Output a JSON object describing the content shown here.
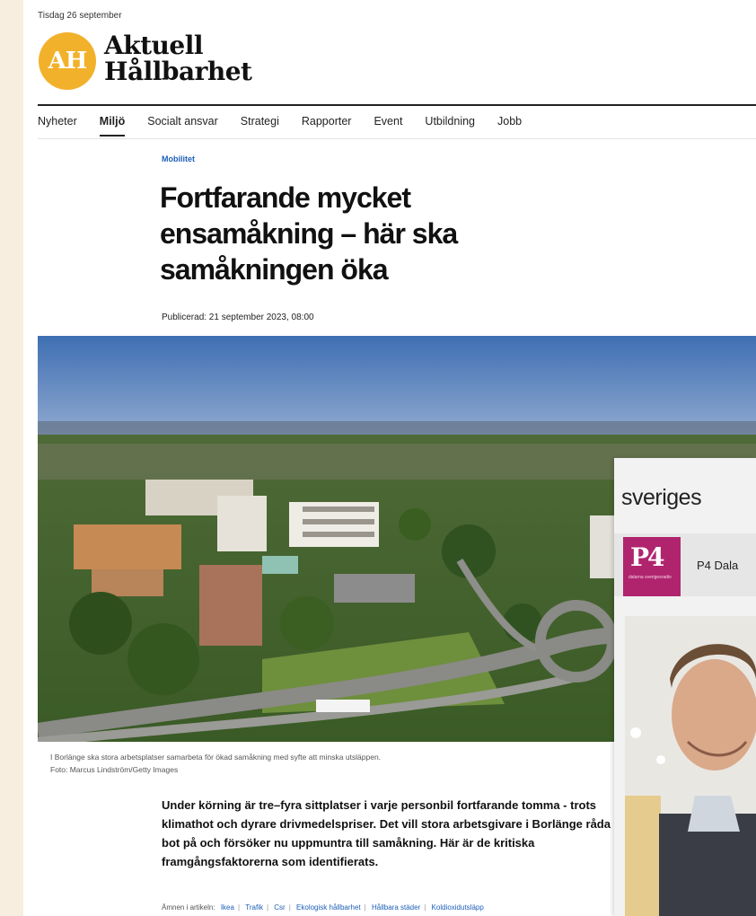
{
  "site": {
    "date": "Tisdag 26 september",
    "logo_initials": "AH",
    "logo_line1": "Aktuell",
    "logo_line2": "Hållbarhet",
    "brand_color": "#f2b12a"
  },
  "nav": {
    "items": [
      {
        "label": "Nyheter",
        "active": false
      },
      {
        "label": "Miljö",
        "active": true
      },
      {
        "label": "Socialt ansvar",
        "active": false
      },
      {
        "label": "Strategi",
        "active": false
      },
      {
        "label": "Rapporter",
        "active": false
      },
      {
        "label": "Event",
        "active": false
      },
      {
        "label": "Utbildning",
        "active": false
      },
      {
        "label": "Jobb",
        "active": false
      }
    ]
  },
  "article": {
    "category": "Mobilitet",
    "headline": "Fortfarande mycket ensamåkning – här ska samåkningen öka",
    "published": "Publicerad: 21 september 2023, 08:00",
    "caption_line1": "I Borlänge ska stora arbetsplatser samarbeta för ökad samåkning med syfte att minska utsläppen.",
    "caption_line2": "Foto: Marcus Lindström/Getty Images",
    "lead": "Under körning är tre–fyra sittplatser i varje personbil fortfarande tomma - trots klimathot och dyrare drivmedelspriser. Det vill stora arbetsgivare i Borlänge råda bot på och försöker nu uppmuntra till samåkning. Här är de kritiska framgångsfaktorerna som identifierats.",
    "topics_label": "Ämnen i artikeln:",
    "topics": [
      "Ikea",
      "Trafik",
      "Csr",
      "Ekologisk hållbarhet",
      "Hållbara städer",
      "Koldioxidutsläpp"
    ],
    "link_color": "#1d5fb8"
  },
  "overlay": {
    "logo_text": "sveriges",
    "channel_badge": "P4",
    "channel_badge_sub": "dalarna sverigesradio",
    "channel_name": "P4 Dala",
    "badge_color": "#b0246e"
  }
}
